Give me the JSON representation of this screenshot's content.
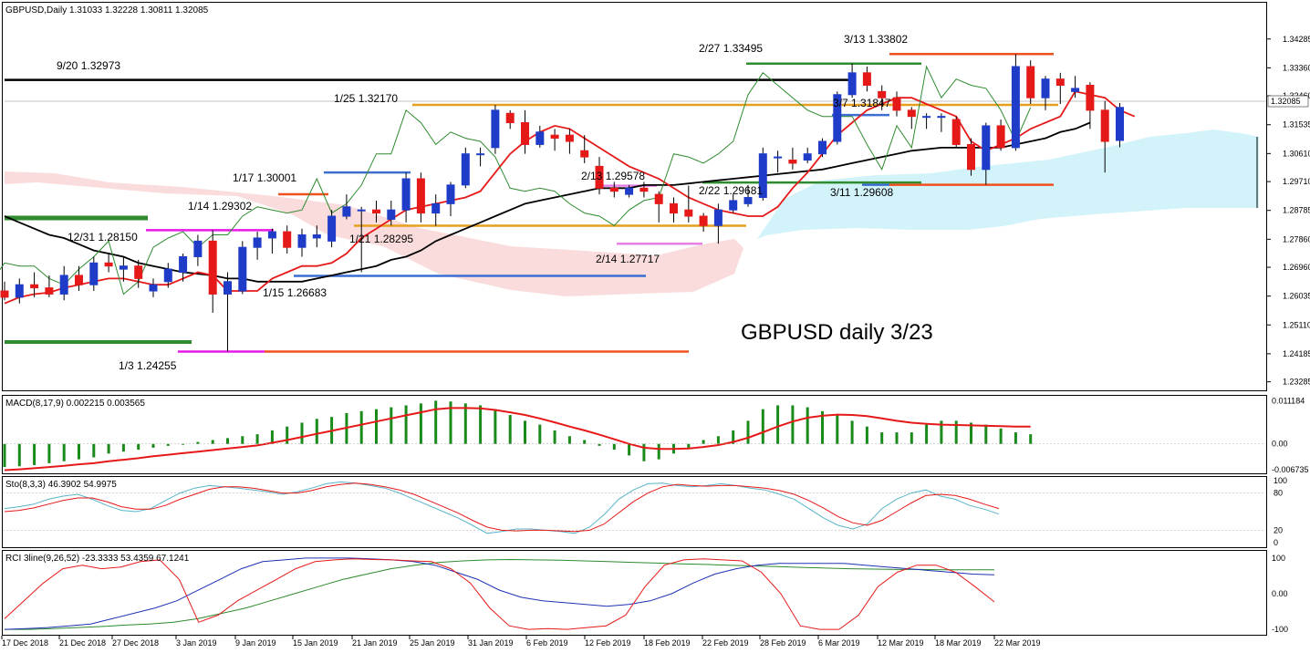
{
  "window": {
    "main_header": "GBPUSD,Daily  1.31033 1.32228 1.30811 1.32085",
    "macd_header": "MACD(8,17,9) 0.002215 0.003565",
    "sto_header": "Sto(8,3,3) 46.3902 54.9975",
    "rci_header": "RCI 3line(9,26,52) -23.3333 53.4359 67.1241",
    "chart_title": "GBPUSD daily 3/23",
    "current_price": "1.32085"
  },
  "colors": {
    "bull": "#1e3cc8",
    "bear": "#e61919",
    "tenkan": "#e61919",
    "kijun": "#000000",
    "chikou": "#2e8b2e",
    "kumo_bear": "#fadcdc",
    "kumo_bull": "#d2f3fa",
    "macd_hist": "#1a8a1a",
    "macd_signal": "#e61919",
    "sto_k": "#5ab4c8",
    "sto_d": "#e61919",
    "rci_short": "#e61919",
    "rci_mid": "#1e32b4",
    "rci_long": "#2e8b2e",
    "marker_green": "#2e8b2e",
    "marker_magenta": "#e619e6",
    "marker_orange": "#f0501e",
    "marker_gold": "#e6a01e",
    "marker_blue": "#3c6ed2",
    "marker_violet": "#e680e6",
    "marker_black": "#000000"
  },
  "chart_data": [
    {
      "type": "candlestick",
      "pane": "main",
      "symbol": "GBPUSD",
      "timeframe": "Daily",
      "y_ticks": [
        "1.34285",
        "1.33360",
        "1.32460",
        "1.31535",
        "1.30610",
        "1.29710",
        "1.28785",
        "1.27860",
        "1.26960",
        "1.26035",
        "1.25110",
        "1.24185",
        "1.23285"
      ],
      "ylim": [
        1.2307,
        1.346
      ],
      "x_ticks": [
        "17 Dec 2018",
        "21 Dec 2018",
        "27 Dec 2018",
        "3 Jan 2019",
        "9 Jan 2019",
        "15 Jan 2019",
        "21 Jan 2019",
        "25 Jan 2019",
        "31 Jan 2019",
        "6 Feb 2019",
        "12 Feb 2019",
        "18 Feb 2019",
        "22 Feb 2019",
        "28 Feb 2019",
        "6 Mar 2019",
        "12 Mar 2019",
        "18 Mar 2019",
        "22 Mar 2019"
      ],
      "ohlc": [
        [
          1.262,
          1.265,
          1.259,
          1.26
        ],
        [
          1.26,
          1.266,
          1.258,
          1.264
        ],
        [
          1.264,
          1.268,
          1.26,
          1.263
        ],
        [
          1.263,
          1.267,
          1.26,
          1.261
        ],
        [
          1.261,
          1.27,
          1.259,
          1.267
        ],
        [
          1.267,
          1.27,
          1.262,
          1.264
        ],
        [
          1.264,
          1.273,
          1.262,
          1.271
        ],
        [
          1.271,
          1.274,
          1.268,
          1.27
        ],
        [
          1.269,
          1.273,
          1.265,
          1.27
        ],
        [
          1.27,
          1.272,
          1.263,
          1.266
        ],
        [
          1.262,
          1.266,
          1.26,
          1.264
        ],
        [
          1.265,
          1.271,
          1.263,
          1.269
        ],
        [
          1.268,
          1.274,
          1.265,
          1.273
        ],
        [
          1.273,
          1.28,
          1.27,
          1.278
        ],
        [
          1.278,
          1.2815,
          1.255,
          1.261
        ],
        [
          1.261,
          1.268,
          1.2426,
          1.265
        ],
        [
          1.262,
          1.278,
          1.261,
          1.276
        ],
        [
          1.276,
          1.281,
          1.272,
          1.279
        ],
        [
          1.279,
          1.282,
          1.274,
          1.281
        ],
        [
          1.281,
          1.283,
          1.274,
          1.276
        ],
        [
          1.276,
          1.282,
          1.273,
          1.28
        ],
        [
          1.279,
          1.283,
          1.276,
          1.28
        ],
        [
          1.278,
          1.288,
          1.276,
          1.286
        ],
        [
          1.286,
          1.293,
          1.285,
          1.289
        ],
        [
          1.288,
          1.289,
          1.268,
          1.288
        ],
        [
          1.288,
          1.291,
          1.284,
          1.287
        ],
        [
          1.285,
          1.291,
          1.283,
          1.288
        ],
        [
          1.288,
          1.3,
          1.284,
          1.298
        ],
        [
          1.298,
          1.3,
          1.284,
          1.287
        ],
        [
          1.287,
          1.293,
          1.2829,
          1.29
        ],
        [
          1.29,
          1.297,
          1.286,
          1.296
        ],
        [
          1.296,
          1.308,
          1.295,
          1.306
        ],
        [
          1.306,
          1.308,
          1.302,
          1.306
        ],
        [
          1.308,
          1.3217,
          1.306,
          1.32
        ],
        [
          1.319,
          1.32,
          1.314,
          1.316
        ],
        [
          1.316,
          1.32,
          1.306,
          1.309
        ],
        [
          1.309,
          1.315,
          1.308,
          1.313
        ],
        [
          1.312,
          1.314,
          1.307,
          1.311
        ],
        [
          1.312,
          1.314,
          1.306,
          1.31
        ],
        [
          1.307,
          1.312,
          1.303,
          1.305
        ],
        [
          1.302,
          1.305,
          1.293,
          1.295
        ],
        [
          1.295,
          1.297,
          1.292,
          1.294
        ],
        [
          1.293,
          1.296,
          1.292,
          1.295
        ],
        [
          1.295,
          1.297,
          1.292,
          1.294
        ],
        [
          1.293,
          1.294,
          1.284,
          1.29
        ],
        [
          1.29,
          1.292,
          1.284,
          1.287
        ],
        [
          1.288,
          1.2958,
          1.284,
          1.286
        ],
        [
          1.286,
          1.287,
          1.281,
          1.283
        ],
        [
          1.283,
          1.29,
          1.2772,
          1.288
        ],
        [
          1.288,
          1.293,
          1.287,
          1.291
        ],
        [
          1.29,
          1.296,
          1.289,
          1.292
        ],
        [
          1.292,
          1.308,
          1.291,
          1.306
        ],
        [
          1.305,
          1.307,
          1.3,
          1.305
        ],
        [
          1.304,
          1.308,
          1.301,
          1.303
        ],
        [
          1.304,
          1.308,
          1.303,
          1.306
        ],
        [
          1.306,
          1.311,
          1.305,
          1.31
        ],
        [
          1.31,
          1.326,
          1.309,
          1.325
        ],
        [
          1.325,
          1.335,
          1.324,
          1.332
        ],
        [
          1.332,
          1.334,
          1.326,
          1.328
        ],
        [
          1.326,
          1.328,
          1.32,
          1.324
        ],
        [
          1.324,
          1.326,
          1.318,
          1.32
        ],
        [
          1.32,
          1.321,
          1.314,
          1.318
        ],
        [
          1.318,
          1.319,
          1.314,
          1.318
        ],
        [
          1.318,
          1.319,
          1.313,
          1.318
        ],
        [
          1.317,
          1.318,
          1.308,
          1.309
        ],
        [
          1.309,
          1.311,
          1.299,
          1.301
        ],
        [
          1.301,
          1.316,
          1.2961,
          1.315
        ],
        [
          1.315,
          1.317,
          1.307,
          1.308
        ],
        [
          1.308,
          1.338,
          1.307,
          1.334
        ],
        [
          1.334,
          1.336,
          1.322,
          1.324
        ],
        [
          1.324,
          1.331,
          1.32,
          1.33
        ],
        [
          1.33,
          1.332,
          1.322,
          1.328
        ],
        [
          1.326,
          1.331,
          1.324,
          1.327
        ],
        [
          1.328,
          1.329,
          1.314,
          1.32
        ],
        [
          1.32,
          1.323,
          1.3,
          1.31
        ],
        [
          1.3103,
          1.3223,
          1.3081,
          1.3209
        ]
      ],
      "indicators": {
        "tenkan": [
          1.258,
          1.26,
          1.261,
          1.2615,
          1.263,
          1.264,
          1.265,
          1.266,
          1.266,
          1.265,
          1.264,
          1.264,
          1.266,
          1.268,
          1.267,
          1.262,
          1.262,
          1.262,
          1.266,
          1.268,
          1.27,
          1.27,
          1.271,
          1.274,
          1.279,
          1.282,
          1.285,
          1.288,
          1.289,
          1.29,
          1.291,
          1.292,
          1.294,
          1.3,
          1.306,
          1.31,
          1.313,
          1.315,
          1.314,
          1.311,
          1.308,
          1.305,
          1.302,
          1.3,
          1.298,
          1.295,
          1.292,
          1.29,
          1.288,
          1.287,
          1.286,
          1.286,
          1.289,
          1.295,
          1.3,
          1.306,
          1.312,
          1.316,
          1.32,
          1.322,
          1.324,
          1.324,
          1.322,
          1.32,
          1.318,
          1.31,
          1.307,
          1.309,
          1.311,
          1.314,
          1.316,
          1.318,
          1.326,
          1.325,
          1.324,
          1.32,
          1.318
        ],
        "kijun": [
          1.286,
          1.284,
          1.282,
          1.28,
          1.279,
          1.277,
          1.275,
          1.274,
          1.273,
          1.271,
          1.27,
          1.269,
          1.268,
          1.2675,
          1.267,
          1.266,
          1.266,
          1.265,
          1.265,
          1.265,
          1.265,
          1.266,
          1.267,
          1.268,
          1.269,
          1.27,
          1.272,
          1.273,
          1.275,
          1.278,
          1.28,
          1.282,
          1.284,
          1.286,
          1.288,
          1.29,
          1.291,
          1.292,
          1.293,
          1.294,
          1.295,
          1.295,
          1.295,
          1.296,
          1.296,
          1.296,
          1.2965,
          1.297,
          1.2975,
          1.298,
          1.2985,
          1.299,
          1.2995,
          1.3,
          1.3005,
          1.301,
          1.302,
          1.303,
          1.304,
          1.305,
          1.306,
          1.307,
          1.3075,
          1.308,
          1.308,
          1.308,
          1.308,
          1.308,
          1.309,
          1.31,
          1.311,
          1.313,
          1.314,
          1.316
        ]
      },
      "annotations": [
        "9/20 1.32973",
        "12/31 1.28150",
        "1/3 1.24255",
        "1/14 1.29302",
        "1/15 1.26683",
        "1/17 1.30001",
        "1/21 1.28295",
        "1/25 1.32170",
        "2/13 1.29578",
        "2/14 1.27717",
        "2/22 1.29681",
        "2/27 1.33495",
        "3/7 1.31847",
        "3/11 1.29608",
        "3/13 1.33802"
      ]
    },
    {
      "type": "bar",
      "pane": "MACD",
      "y_ticks": [
        "0.011184",
        "0.00",
        "-0.006735"
      ],
      "ylim": [
        -0.0074,
        0.012
      ],
      "values": [
        -0.006,
        -0.0058,
        -0.0055,
        -0.005,
        -0.0045,
        -0.004,
        -0.0035,
        -0.0025,
        -0.002,
        -0.0015,
        -0.001,
        -0.0005,
        0.0,
        0.0005,
        0.001,
        0.0015,
        0.002,
        0.0025,
        0.0035,
        0.0045,
        0.0055,
        0.0065,
        0.007,
        0.008,
        0.0085,
        0.009,
        0.0095,
        0.01,
        0.0105,
        0.0112,
        0.011,
        0.0105,
        0.01,
        0.009,
        0.0075,
        0.006,
        0.005,
        0.0035,
        0.002,
        0.001,
        -0.0005,
        -0.0015,
        -0.003,
        -0.0045,
        -0.004,
        -0.0025,
        -0.001,
        0.001,
        0.002,
        0.0035,
        0.006,
        0.009,
        0.01,
        0.01,
        0.0095,
        0.0085,
        0.0075,
        0.006,
        0.0045,
        0.003,
        0.003,
        0.003,
        0.005,
        0.006,
        0.006,
        0.0055,
        0.005,
        0.004,
        0.003,
        0.0025
      ],
      "signal": [
        -0.0068,
        -0.0066,
        -0.0063,
        -0.006,
        -0.0057,
        -0.0053,
        -0.005,
        -0.0045,
        -0.0041,
        -0.0037,
        -0.0032,
        -0.0028,
        -0.0024,
        -0.002,
        -0.0016,
        -0.0012,
        -0.0008,
        -0.0004,
        0.0003,
        0.001,
        0.0018,
        0.0026,
        0.0034,
        0.0042,
        0.005,
        0.0058,
        0.0066,
        0.0074,
        0.0082,
        0.009,
        0.0093,
        0.0093,
        0.0092,
        0.0088,
        0.0082,
        0.0075,
        0.0066,
        0.0056,
        0.0045,
        0.0035,
        0.0024,
        0.0012,
        0.0,
        -0.001,
        -0.0013,
        -0.0013,
        -0.0012,
        -0.0008,
        -0.0003,
        0.0005,
        0.0016,
        0.003,
        0.0045,
        0.0058,
        0.0068,
        0.0073,
        0.0076,
        0.0075,
        0.0072,
        0.0066,
        0.006,
        0.0055,
        0.0052,
        0.005,
        0.0049,
        0.0048,
        0.0047,
        0.0046,
        0.0045,
        0.0045
      ]
    },
    {
      "type": "line",
      "pane": "Stochastic",
      "y_ticks": [
        "100",
        "80",
        "20",
        "0"
      ],
      "ylim": [
        0,
        100
      ],
      "series": [
        {
          "values": [
            55,
            58,
            62,
            70,
            75,
            78,
            70,
            60,
            52,
            50,
            55,
            68,
            80,
            88,
            92,
            90,
            88,
            85,
            82,
            78,
            82,
            88,
            95,
            98,
            96,
            92,
            88,
            80,
            70,
            60,
            50,
            40,
            28,
            15,
            18,
            22,
            22,
            20,
            18,
            15,
            25,
            45,
            70,
            85,
            95,
            96,
            92,
            90,
            92,
            95,
            92,
            88,
            85,
            78,
            70,
            55,
            40,
            28,
            22,
            30,
            55,
            70,
            80,
            85,
            75,
            70,
            60,
            54,
            46
          ]
        },
        {
          "values": [
            50,
            52,
            56,
            62,
            68,
            72,
            72,
            66,
            58,
            54,
            54,
            60,
            70,
            78,
            86,
            90,
            90,
            88,
            84,
            80,
            80,
            84,
            90,
            94,
            96,
            94,
            90,
            85,
            78,
            68,
            58,
            48,
            36,
            25,
            20,
            19,
            20,
            20,
            19,
            18,
            20,
            30,
            48,
            66,
            80,
            90,
            94,
            92,
            91,
            92,
            92,
            90,
            88,
            84,
            78,
            68,
            56,
            42,
            32,
            28,
            36,
            50,
            64,
            76,
            78,
            76,
            70,
            62,
            55
          ]
        }
      ]
    },
    {
      "type": "line",
      "pane": "RCI",
      "y_ticks": [
        "100",
        "0.00",
        "-100"
      ],
      "ylim": [
        -110,
        110
      ],
      "series": [
        {
          "values": [
            -70,
            -20,
            30,
            70,
            80,
            70,
            75,
            90,
            95,
            40,
            -80,
            -60,
            -20,
            10,
            40,
            70,
            90,
            95,
            98,
            96,
            95,
            92,
            90,
            70,
            30,
            -40,
            -90,
            -100,
            -98,
            -100,
            -95,
            -90,
            -60,
            20,
            80,
            95,
            98,
            95,
            92,
            60,
            0,
            -90,
            -100,
            -100,
            -60,
            20,
            60,
            80,
            80,
            60,
            20,
            -23
          ]
        },
        {
          "values": [
            -100,
            -98,
            -95,
            -90,
            -85,
            -70,
            -55,
            -40,
            -20,
            10,
            40,
            70,
            90,
            95,
            100,
            100,
            100,
            98,
            95,
            90,
            80,
            60,
            40,
            10,
            -10,
            -20,
            -25,
            -30,
            -35,
            -30,
            -20,
            0,
            30,
            55,
            70,
            80,
            85,
            85,
            85,
            85,
            80,
            75,
            70,
            65,
            60,
            55,
            53
          ]
        },
        {
          "values": [
            -100,
            -100,
            -98,
            -95,
            -92,
            -88,
            -85,
            -80,
            -70,
            -55,
            -40,
            -20,
            0,
            20,
            40,
            55,
            70,
            80,
            88,
            92,
            95,
            96,
            95,
            94,
            92,
            90,
            88,
            86,
            84,
            82,
            80,
            78,
            76,
            74,
            72,
            70,
            69,
            68,
            68,
            67,
            67,
            67
          ]
        }
      ]
    }
  ]
}
